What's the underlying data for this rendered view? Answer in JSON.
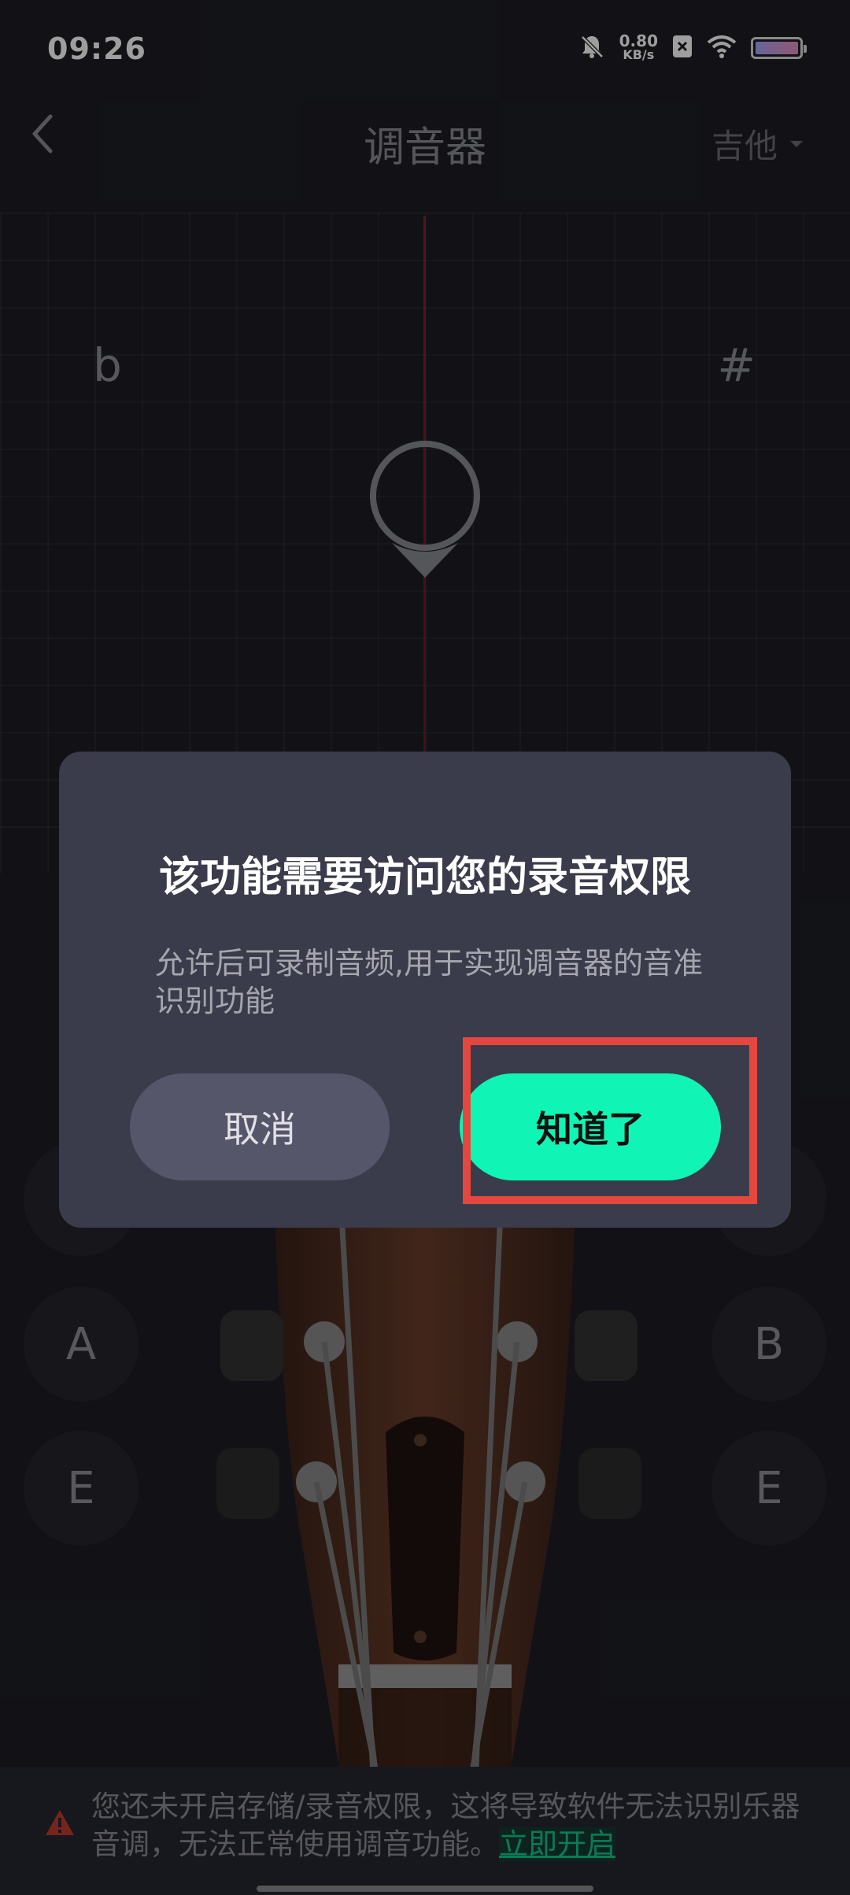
{
  "status_bar": {
    "time": "09:26",
    "net_speed_value": "0.80",
    "net_speed_unit": "KB/s",
    "icons": [
      "mute-bell-icon",
      "close-box-icon",
      "wifi-icon",
      "battery-icon"
    ]
  },
  "header": {
    "title": "调音器",
    "instrument": "吉他"
  },
  "tuner": {
    "flat_symbol": "b",
    "sharp_symbol": "#"
  },
  "strings": {
    "left": [
      "A",
      "E"
    ],
    "right": [
      "B",
      "E"
    ]
  },
  "dialog": {
    "title": "该功能需要访问您的录音权限",
    "message": "允许后可录制音频,用于实现调音器的音准识别功能",
    "cancel_label": "取消",
    "confirm_label": "知道了"
  },
  "warning": {
    "text": "您还未开启存储/录音权限，这将导致软件无法识别乐器音调，无法正常使用调音功能。",
    "link_label": "立即开启"
  },
  "colors": {
    "background": "#1d1e25",
    "dialog_bg": "#3b3c4b",
    "accent_green": "#10f5b5",
    "highlight_red": "#e5473f",
    "link_green": "#12c58a"
  }
}
